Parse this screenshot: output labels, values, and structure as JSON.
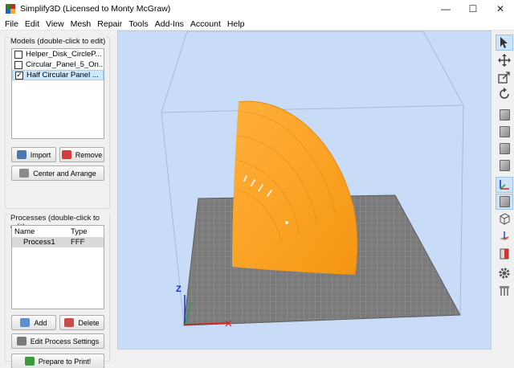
{
  "window": {
    "title": "Simplify3D (Licensed to Monty McGraw)",
    "minimize": "—",
    "maximize": "☐",
    "close": "✕"
  },
  "menu": [
    "File",
    "Edit",
    "View",
    "Mesh",
    "Repair",
    "Tools",
    "Add-Ins",
    "Account",
    "Help"
  ],
  "models": {
    "title": "Models (double-click to edit)",
    "items": [
      {
        "label": "Helper_Disk_CircleP...",
        "checked": false
      },
      {
        "label": "Circular_Panel_5_On...",
        "checked": false
      },
      {
        "label": "Half Circular Panel ...",
        "checked": true
      }
    ],
    "import": "Import",
    "remove": "Remove",
    "center": "Center and Arrange"
  },
  "processes": {
    "title": "Processes (double-click to edit)",
    "col_name": "Name",
    "col_type": "Type",
    "rows": [
      {
        "name": "Process1",
        "type": "FFF"
      }
    ],
    "add": "Add",
    "delete": "Delete",
    "edit": "Edit Process Settings",
    "prepare": "Prepare to Print!"
  },
  "viewport": {
    "axis_z": "Z",
    "background": "#c8dcf8",
    "bed_color": "#7a7a7a",
    "model_color": "#ffa31f"
  },
  "toolbar_icons": [
    "select-arrow-icon",
    "move-icon",
    "scale-icon",
    "rotate-icon",
    "view-default-icon",
    "view-front-icon",
    "view-top-icon",
    "view-side-icon",
    "coordinate-axes-icon",
    "solid-view-icon",
    "wireframe-view-icon",
    "build-platform-icon",
    "cross-section-icon",
    "settings-gear-icon",
    "supports-icon"
  ]
}
